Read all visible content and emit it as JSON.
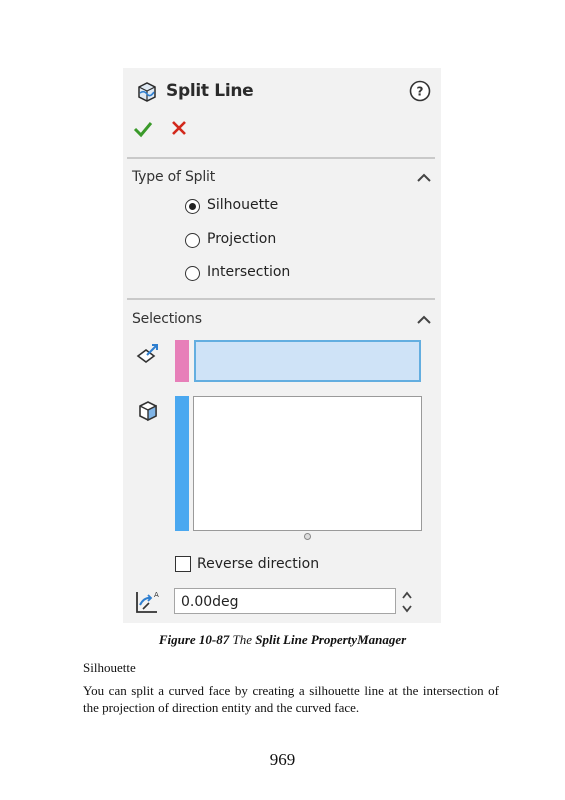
{
  "property_manager": {
    "title": "Split Line",
    "icons": {
      "title": "split-line-icon",
      "help": "help-icon",
      "ok": "checkmark-icon",
      "cancel": "close-icon"
    },
    "type_of_split": {
      "title": "Type of Split",
      "options": [
        "Silhouette",
        "Projection",
        "Intersection"
      ],
      "selected": "Silhouette"
    },
    "selections": {
      "title": "Selections",
      "direction_box_color": "#e77fb9",
      "faces_box_color": "#4aa8f0",
      "reverse_direction_label": "Reverse direction",
      "reverse_direction_checked": false,
      "angle_value": "0.00deg"
    }
  },
  "caption": {
    "figure": "Figure 10-87",
    "the": "The",
    "name": "Split Line PropertyManager"
  },
  "body": {
    "heading": "Silhouette",
    "paragraph": "You can split a curved face by creating a silhouette line at the intersection of the projection of direction entity and the curved face."
  },
  "page_number": "969"
}
